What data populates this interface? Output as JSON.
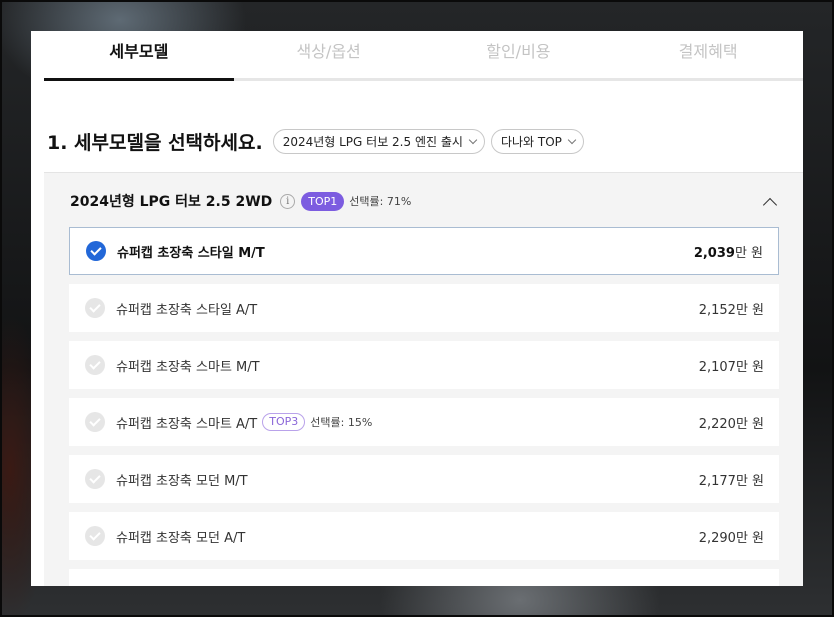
{
  "tabs": [
    {
      "label": "세부모델",
      "active": true
    },
    {
      "label": "색상/옵션",
      "active": false
    },
    {
      "label": "할인/비용",
      "active": false
    },
    {
      "label": "결제혜택",
      "active": false
    }
  ],
  "section": {
    "heading": "1. 세부모델을 선택하세요.",
    "filter_model": "2024년형 LPG 터보 2.5 엔진 출시",
    "filter_sort": "다나와 TOP"
  },
  "group": {
    "title": "2024년형 LPG 터보 2.5 2WD",
    "info_icon": "i",
    "badge": "TOP1",
    "selection_rate": "선택률: 71%",
    "collapse_icon": "chevron-up-icon"
  },
  "items": [
    {
      "name": "슈퍼캡 초장축 스타일 M/T",
      "price_amount": "2,039",
      "price_unit": "만 원",
      "selected": true
    },
    {
      "name": "슈퍼캡 초장축 스타일 A/T",
      "price_amount": "2,152",
      "price_unit": "만 원",
      "selected": false
    },
    {
      "name": "슈퍼캡 초장축 스마트 M/T",
      "price_amount": "2,107",
      "price_unit": "만 원",
      "selected": false
    },
    {
      "name": "슈퍼캡 초장축 스마트 A/T",
      "badge": "TOP3",
      "selection_rate": "선택률: 15%",
      "price_amount": "2,220",
      "price_unit": "만 원",
      "selected": false
    },
    {
      "name": "슈퍼캡 초장축 모던 M/T",
      "price_amount": "2,177",
      "price_unit": "만 원",
      "selected": false
    },
    {
      "name": "슈퍼캡 초장축 모던 A/T",
      "price_amount": "2,290",
      "price_unit": "만 원",
      "selected": false
    }
  ],
  "colors": {
    "accent_check": "#2267d8",
    "badge_top1": "#7c5ce0",
    "badge_top3_border": "#b9a2ea"
  }
}
